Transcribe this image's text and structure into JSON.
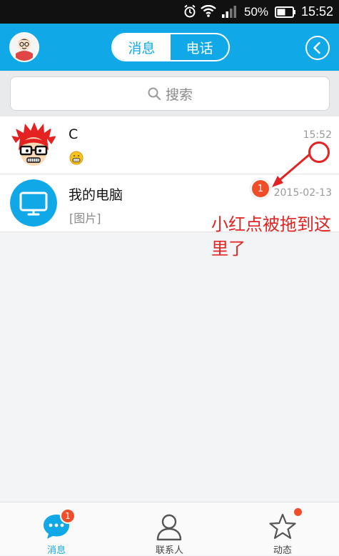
{
  "status_bar": {
    "battery_percent": "50%",
    "time": "15:52",
    "icons": [
      "alarm-icon",
      "wifi-icon",
      "signal-icon",
      "battery-icon"
    ]
  },
  "header": {
    "tabs": [
      {
        "label": "消息",
        "active": true
      },
      {
        "label": "电话",
        "active": false
      }
    ],
    "back_icon": "back-icon"
  },
  "search": {
    "placeholder": "搜索"
  },
  "conversations": [
    {
      "name": "C",
      "preview_icon": "grin-emoji-icon",
      "time": "15:52",
      "avatar": "cartoon-avatar-red-hair"
    },
    {
      "name": "我的电脑",
      "preview": "[图片]",
      "time": "2015-02-13",
      "avatar": "monitor-icon"
    }
  ],
  "annotation": {
    "badge_count": "1",
    "text": "小红点被拖到这里了"
  },
  "bottom_nav": [
    {
      "label": "消息",
      "icon": "chat-icon",
      "active": true,
      "badge": "1"
    },
    {
      "label": "联系人",
      "icon": "contacts-icon",
      "active": false
    },
    {
      "label": "动态",
      "icon": "star-icon",
      "active": false,
      "dot": true
    }
  ],
  "colors": {
    "primary": "#11a8e8",
    "badge": "#f04e2a",
    "annotation": "#e32222"
  }
}
